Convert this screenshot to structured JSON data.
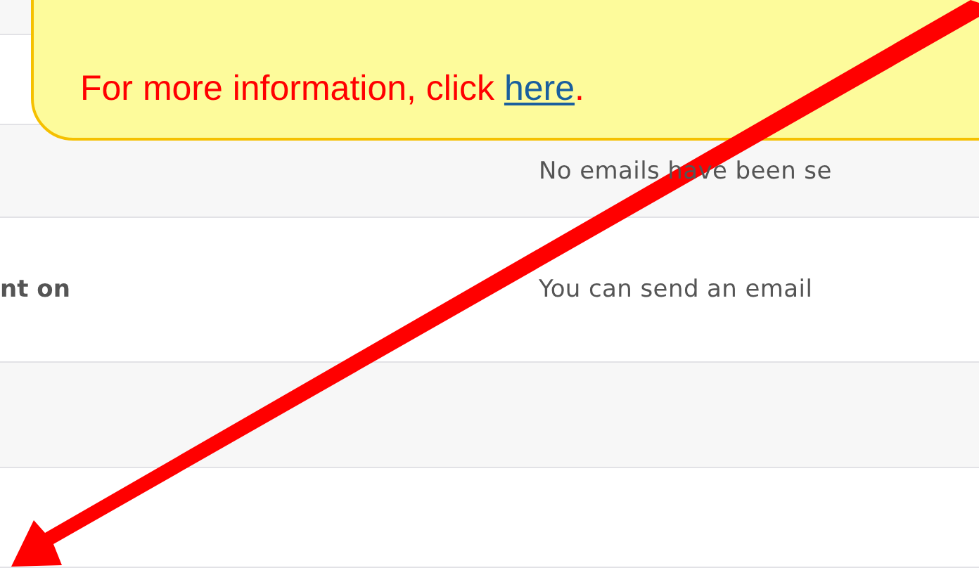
{
  "callout": {
    "text_before": "For more information, click ",
    "link": "here",
    "text_after": "."
  },
  "rows": [
    {},
    {},
    {
      "value": "No emails have been se"
    },
    {
      "label": "nt on",
      "value": "You can send an email"
    },
    {},
    {}
  ]
}
